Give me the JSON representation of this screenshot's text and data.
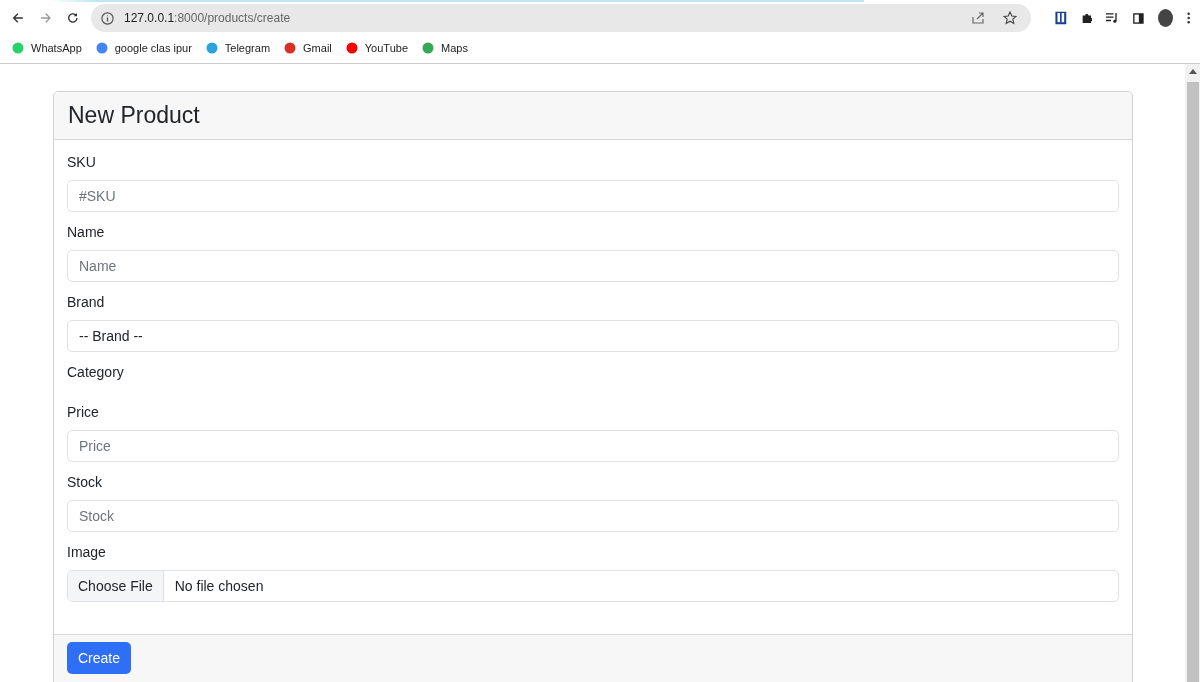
{
  "browser": {
    "url_host": "127.0.0.1",
    "url_path": ":8000/products/create",
    "bookmarks": [
      {
        "label": "WhatsApp",
        "kind": "whatsapp"
      },
      {
        "label": "google clas ipur",
        "kind": "google"
      },
      {
        "label": "Telegram",
        "kind": "telegram"
      },
      {
        "label": "Gmail",
        "kind": "gmail"
      },
      {
        "label": "YouTube",
        "kind": "youtube"
      },
      {
        "label": "Maps",
        "kind": "maps"
      }
    ]
  },
  "card": {
    "title": "New Product",
    "fields": [
      {
        "label": "SKU",
        "kind": "text",
        "placeholder": "#SKU"
      },
      {
        "label": "Name",
        "kind": "text",
        "placeholder": "Name"
      },
      {
        "label": "Brand",
        "kind": "select",
        "value": "-- Brand --"
      },
      {
        "label": "Category",
        "kind": "none"
      },
      {
        "label": "Price",
        "kind": "text",
        "placeholder": "Price"
      },
      {
        "label": "Stock",
        "kind": "text",
        "placeholder": "Stock"
      },
      {
        "label": "Image",
        "kind": "file",
        "button": "Choose File",
        "value": "No file chosen"
      }
    ],
    "submit": "Create"
  }
}
